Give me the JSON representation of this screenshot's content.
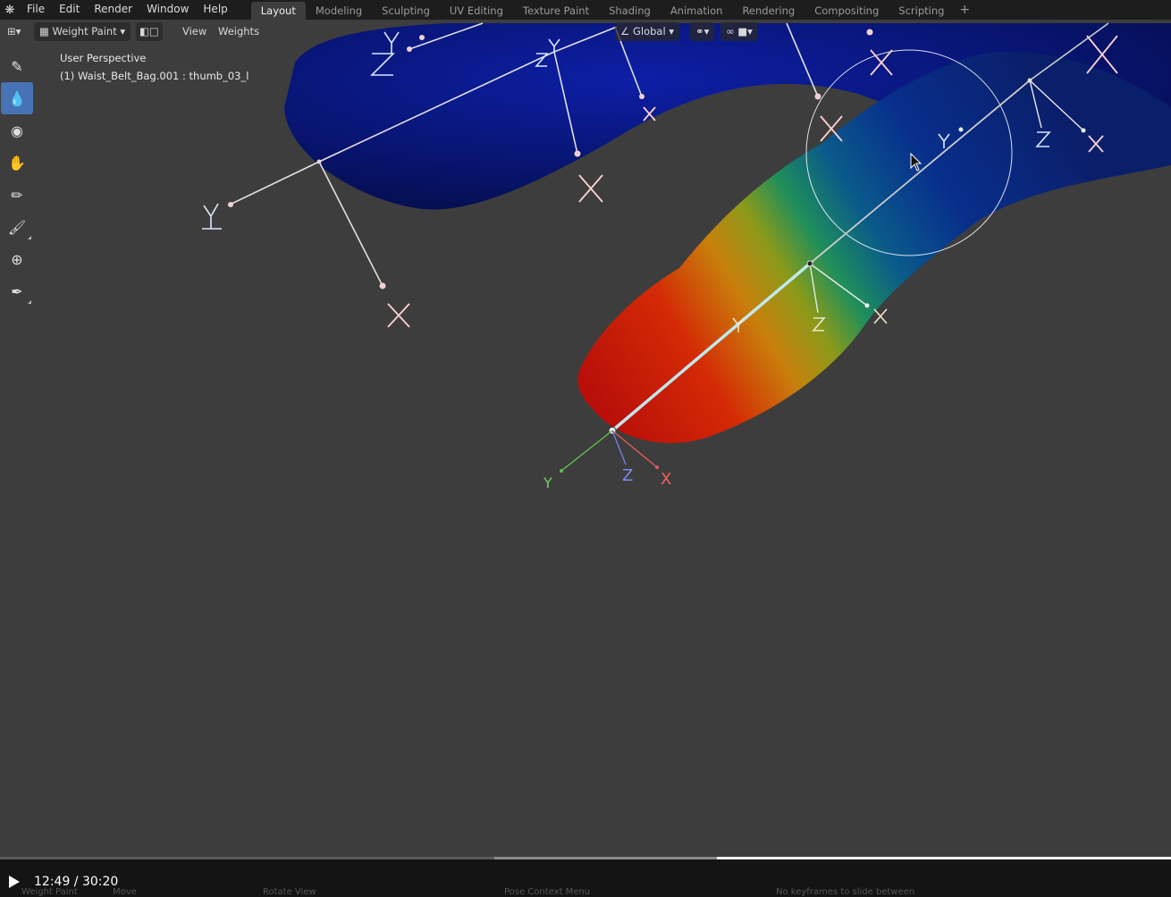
{
  "menu": {
    "items": [
      "File",
      "Edit",
      "Render",
      "Window",
      "Help"
    ]
  },
  "workspaces": {
    "tabs": [
      "Layout",
      "Modeling",
      "Sculpting",
      "UV Editing",
      "Texture Paint",
      "Shading",
      "Animation",
      "Rendering",
      "Compositing",
      "Scripting"
    ],
    "active": "Layout"
  },
  "header": {
    "mode": "Weight Paint",
    "view": "View",
    "weights": "Weights",
    "orientation": "Global"
  },
  "viewport": {
    "perspective": "User Perspective",
    "object_info": "(1) Waist_Belt_Bag.001 : thumb_03_l",
    "axis_labels": {
      "x": "X",
      "y": "Y",
      "z": "Z"
    }
  },
  "tools": [
    "draw-brush",
    "blur-brush",
    "average-brush",
    "smear-brush",
    "sample-weight",
    "gradient",
    "cursor",
    "annotate"
  ],
  "player": {
    "time": "12:49 / 30:20",
    "progress": 0.4225
  },
  "statusbar": {
    "items": [
      "Weight Paint",
      "Move",
      "Rotate View",
      "Pose Context Menu",
      "No keyframes to slide between"
    ]
  },
  "colors": {
    "accent": "#4772b3",
    "background": "#3d3d3d",
    "topbar": "#1d1d1d"
  }
}
